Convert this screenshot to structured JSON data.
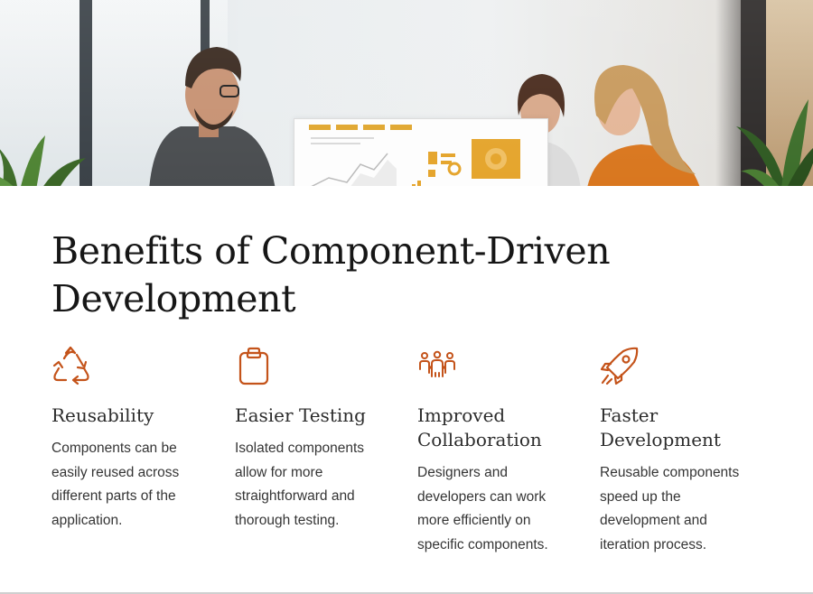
{
  "hero": {
    "image_description_icon": "team-office-photo"
  },
  "title": "Benefits of Component-Driven Development",
  "accent_color": "#c4531a",
  "benefits": [
    {
      "icon": "recycle-icon",
      "heading": "Reusability",
      "text": "Components can be easily reused across different parts of the application."
    },
    {
      "icon": "clipboard-icon",
      "heading": "Easier Testing",
      "text": "Isolated components allow for more straightforward and thorough testing."
    },
    {
      "icon": "team-icon",
      "heading": "Improved Collaboration",
      "text": "Designers and developers can work more efficiently on specific components."
    },
    {
      "icon": "rocket-icon",
      "heading": "Faster Development",
      "text": "Reusable components speed up the development and iteration process."
    }
  ]
}
